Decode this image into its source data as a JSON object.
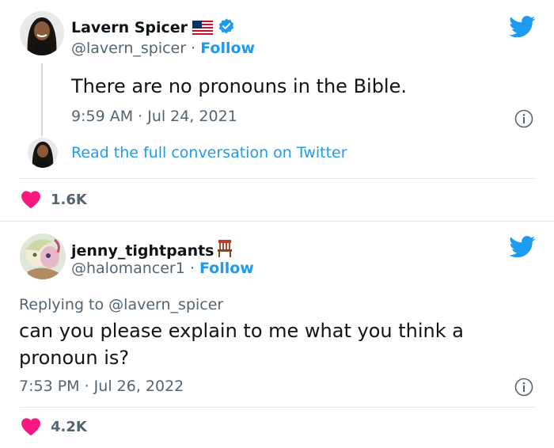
{
  "tweet1": {
    "display_name": "Lavern Spicer",
    "handle": "@lavern_spicer",
    "separator": "·",
    "follow_label": "Follow",
    "text": "There are no pronouns in the Bible.",
    "timestamp": "9:59 AM · Jul 24, 2021",
    "read_conversation": "Read the full conversation on Twitter",
    "likes": "1.6K"
  },
  "tweet2": {
    "display_name": "jenny_tightpants",
    "handle": "@halomancer1",
    "separator": "·",
    "follow_label": "Follow",
    "replying_prefix": "Replying to",
    "replying_to": "@lavern_spicer",
    "text": "can you please explain to me what you think a pronoun is?",
    "timestamp": "7:53 PM · Jul 26, 2022",
    "likes": "4.2K"
  },
  "colors": {
    "twitter_blue": "#1d9bf0",
    "heart_red": "#f91880",
    "muted_text": "#536471"
  },
  "icons": [
    "twitter-bird-icon",
    "verified-badge-icon",
    "us-flag-icon",
    "chair-icon",
    "info-icon",
    "heart-icon"
  ]
}
